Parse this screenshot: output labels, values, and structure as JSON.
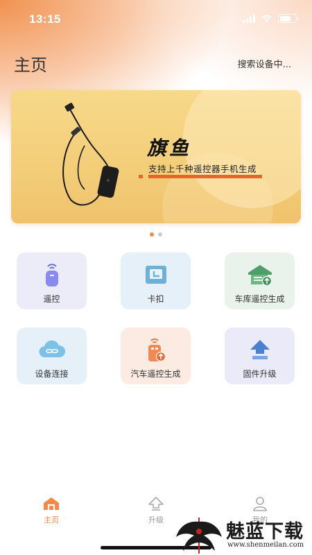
{
  "status_bar": {
    "time": "13:15"
  },
  "header": {
    "title": "主页",
    "search_status": "搜索设备中..."
  },
  "banner": {
    "brand": "旗鱼",
    "slogan": "支持上千种遥控器手机生成",
    "colors": {
      "background": "#f3cd78",
      "accent": "#e8652a"
    }
  },
  "carousel": {
    "pages": 2,
    "active": 1
  },
  "features": [
    {
      "label": "遥控",
      "icon": "remote-icon",
      "bg": "#ececf8"
    },
    {
      "label": "卡扣",
      "icon": "buckle-icon",
      "bg": "#e6f0f8"
    },
    {
      "label": "车库遥控生成",
      "icon": "garage-icon",
      "bg": "#e9f3ec"
    },
    {
      "label": "设备连接",
      "icon": "cloud-link-icon",
      "bg": "#e6f0f8"
    },
    {
      "label": "汽车遥控生成",
      "icon": "car-remote-icon",
      "bg": "#fcebe3"
    },
    {
      "label": "固件升级",
      "icon": "firmware-upload-icon",
      "bg": "#ebeaf8"
    }
  ],
  "tab_bar": {
    "tabs": [
      {
        "label": "主页",
        "icon": "home-icon",
        "active": true
      },
      {
        "label": "升级",
        "icon": "upgrade-icon",
        "active": false
      },
      {
        "label": "我的",
        "icon": "profile-icon",
        "active": false
      }
    ],
    "active_color": "#f08a4b",
    "inactive_color": "#999999"
  },
  "watermark": {
    "text": "魅蓝下载",
    "url": "www.shenmeilan.com"
  }
}
